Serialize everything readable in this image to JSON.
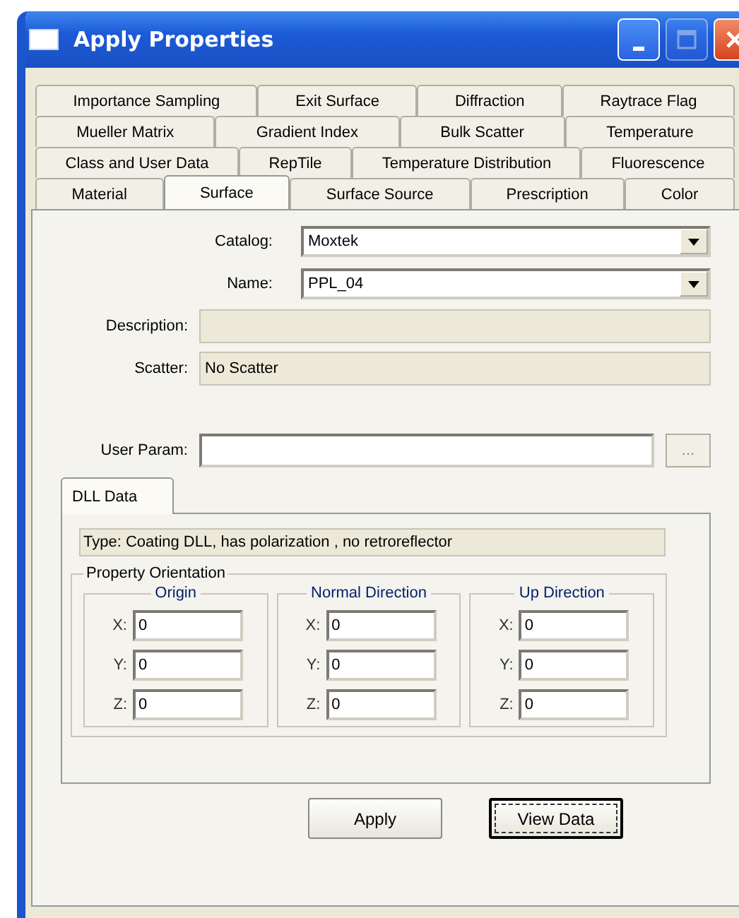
{
  "window": {
    "title": "Apply Properties",
    "controls": [
      {
        "kind": "minimize",
        "disabled": false
      },
      {
        "kind": "maximize",
        "disabled": true
      },
      {
        "kind": "close",
        "disabled": false
      }
    ]
  },
  "tab_rows": [
    [
      {
        "label": "Importance Sampling",
        "selected": false
      },
      {
        "label": "Exit Surface",
        "selected": false
      },
      {
        "label": "Diffraction",
        "selected": false
      },
      {
        "label": "Raytrace Flag",
        "selected": false
      }
    ],
    [
      {
        "label": "Mueller Matrix",
        "selected": false
      },
      {
        "label": "Gradient Index",
        "selected": false
      },
      {
        "label": "Bulk Scatter",
        "selected": false
      },
      {
        "label": "Temperature",
        "selected": false
      }
    ],
    [
      {
        "label": "Class and User Data",
        "selected": false
      },
      {
        "label": "RepTile",
        "selected": false
      },
      {
        "label": "Temperature Distribution",
        "selected": false
      },
      {
        "label": "Fluorescence",
        "selected": false
      }
    ],
    [
      {
        "label": "Material",
        "selected": false
      },
      {
        "label": "Surface",
        "selected": true
      },
      {
        "label": "Surface Source",
        "selected": false
      },
      {
        "label": "Prescription",
        "selected": false
      },
      {
        "label": "Color",
        "selected": false
      }
    ]
  ],
  "fields": [
    {
      "kind": "combo",
      "label": "Catalog:",
      "value": "Moxtek"
    },
    {
      "kind": "combo",
      "label": "Name:",
      "value": "PPL_04"
    },
    {
      "kind": "readonly",
      "label": "Description:"
    },
    {
      "kind": "readonly",
      "label": "Scatter:",
      "value": "No Scatter"
    },
    {
      "kind": "browse",
      "label": "User Param:",
      "button": "..."
    }
  ],
  "dll_tabs": [
    {
      "label": "DLL Data",
      "selected": true
    }
  ],
  "dll_type": "Type: Coating DLL, has polarization , no retroreflector",
  "property_orientation": {
    "title": "Property Orientation",
    "groups": [
      {
        "title": "Origin",
        "fields": [
          {
            "label": "X:",
            "value": "0"
          },
          {
            "label": "Y:",
            "value": "0"
          },
          {
            "label": "Z:",
            "value": "0"
          }
        ]
      },
      {
        "title": "Normal Direction",
        "fields": [
          {
            "label": "X:",
            "value": "0"
          },
          {
            "label": "Y:",
            "value": "0"
          },
          {
            "label": "Z:",
            "value": "0"
          }
        ]
      },
      {
        "title": "Up Direction",
        "fields": [
          {
            "label": "X:",
            "value": "0"
          },
          {
            "label": "Y:",
            "value": "0"
          },
          {
            "label": "Z:",
            "value": "0"
          }
        ]
      }
    ]
  },
  "buttons": [
    {
      "label": "Apply",
      "focused": false
    },
    {
      "label": "View Data",
      "focused": true
    }
  ]
}
